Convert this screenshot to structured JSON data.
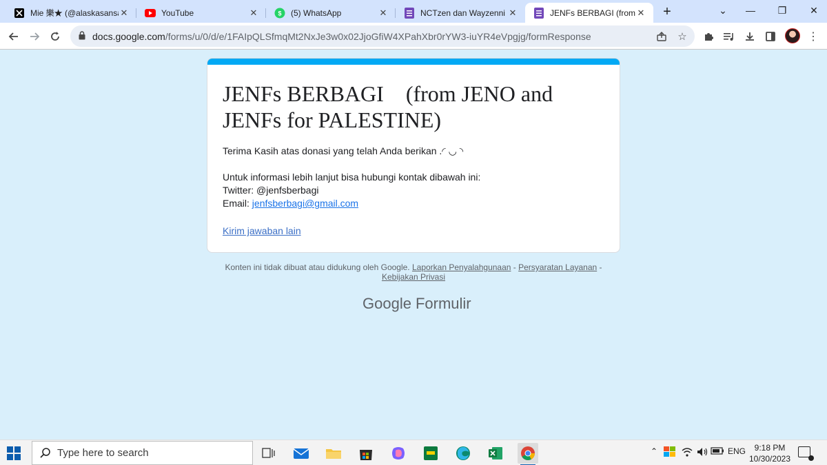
{
  "browser": {
    "tabs": [
      {
        "title": "Mie 樂★ (@alaskasansan",
        "icon": "x-logo-icon",
        "active": false
      },
      {
        "title": "YouTube",
        "icon": "youtube-icon",
        "active": false
      },
      {
        "title": "(5) WhatsApp",
        "icon": "whatsapp-icon",
        "active": false
      },
      {
        "title": "NCTzen dan Wayzenni In",
        "icon": "google-forms-icon",
        "active": false
      },
      {
        "title": "JENFs BERBAGI (from JEN",
        "icon": "google-forms-icon",
        "active": true
      }
    ],
    "url_host": "docs.google.com",
    "url_path": "/forms/u/0/d/e/1FAIpQLSfmqMt2NxJe3w0x02JjoGfiW4XPahXbr0rYW3-iuYR4eVpgjg/formResponse"
  },
  "form": {
    "title": "JENFs BERBAGI    (from JENO and JENFs for PALESTINE)",
    "thanks": "Terima Kasih atas donasi yang telah Anda berikan .◜ ◡ ◝",
    "info_line": "Untuk informasi lebih lanjut bisa hubungi kontak dibawah ini:",
    "twitter": "Twitter: @jenfsberbagi",
    "email_label": "Email: ",
    "email": "jenfsberbagi@gmail.com",
    "another_response": "Kirim jawaban lain"
  },
  "footer": {
    "disclaimer": "Konten ini tidak dibuat atau didukung oleh Google.",
    "report": "Laporkan Penyalahgunaan",
    "dash1": " - ",
    "terms": "Persyaratan Layanan",
    "dash2": " - ",
    "privacy": "Kebijakan Privasi"
  },
  "branding": {
    "google": "Google",
    "product": "Formulir"
  },
  "taskbar": {
    "search_placeholder": "Type here to search",
    "language": "ENG",
    "time": "9:18 PM",
    "date": "10/30/2023"
  },
  "colors": {
    "form_accent": "#03a9f4",
    "page_bg": "#d9effb",
    "link": "#1a73e8"
  }
}
